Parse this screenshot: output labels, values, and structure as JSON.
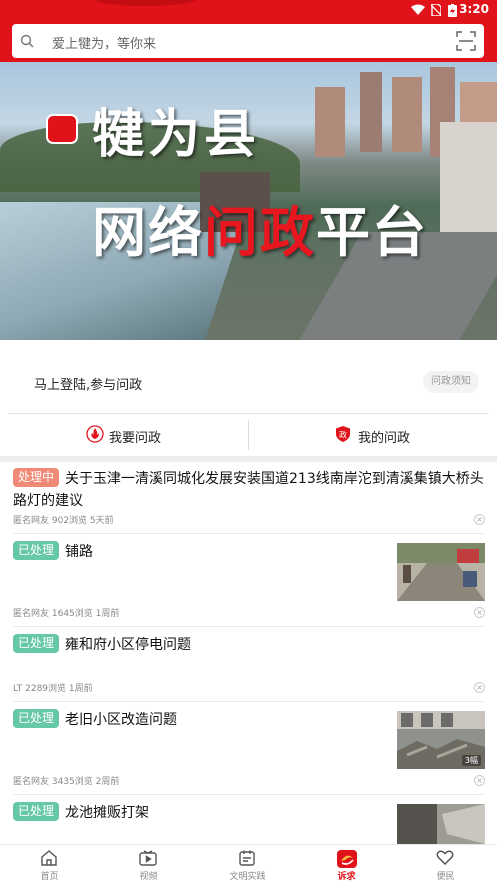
{
  "status_bar": {
    "time": "3:20"
  },
  "search": {
    "placeholder": "爱上犍为，等你来"
  },
  "banner": {
    "line1": "犍为县",
    "line2_a": "网络",
    "line2_b": "问政",
    "line2_c": "平台"
  },
  "login": {
    "prompt": "马上登陆,参与问政",
    "notice_button": "问政须知"
  },
  "tabs": [
    {
      "label": "我要问政"
    },
    {
      "label": "我的问政"
    }
  ],
  "posts": [
    {
      "status": "处理中",
      "title": "关于玉津一清溪同城化发展安装国道213线南岸沱到清溪集镇大桥头路灯的建议",
      "meta": "匿名网友 902浏览 5天前"
    },
    {
      "status": "已处理",
      "title": "铺路",
      "meta": "匿名网友 1645浏览 1周前"
    },
    {
      "status": "已处理",
      "title": "雍和府小区停电问题",
      "meta": "LT 2289浏览 1周前"
    },
    {
      "status": "已处理",
      "title": "老旧小区改造问题",
      "meta": "匿名网友 3435浏览 2周前",
      "image_count": "3幅"
    },
    {
      "status": "已处理",
      "title": "龙池摊贩打架"
    }
  ],
  "bottom_nav": [
    {
      "label": "首页",
      "icon": "home-icon"
    },
    {
      "label": "视频",
      "icon": "video-icon"
    },
    {
      "label": "文明实践",
      "icon": "practice-icon"
    },
    {
      "label": "诉求",
      "icon": "appeal-logo-icon"
    },
    {
      "label": "便民",
      "icon": "heart-icon"
    }
  ],
  "colors": {
    "brand_red": "#e0121a",
    "processing": "#f08a76",
    "done": "#66c8a4"
  }
}
